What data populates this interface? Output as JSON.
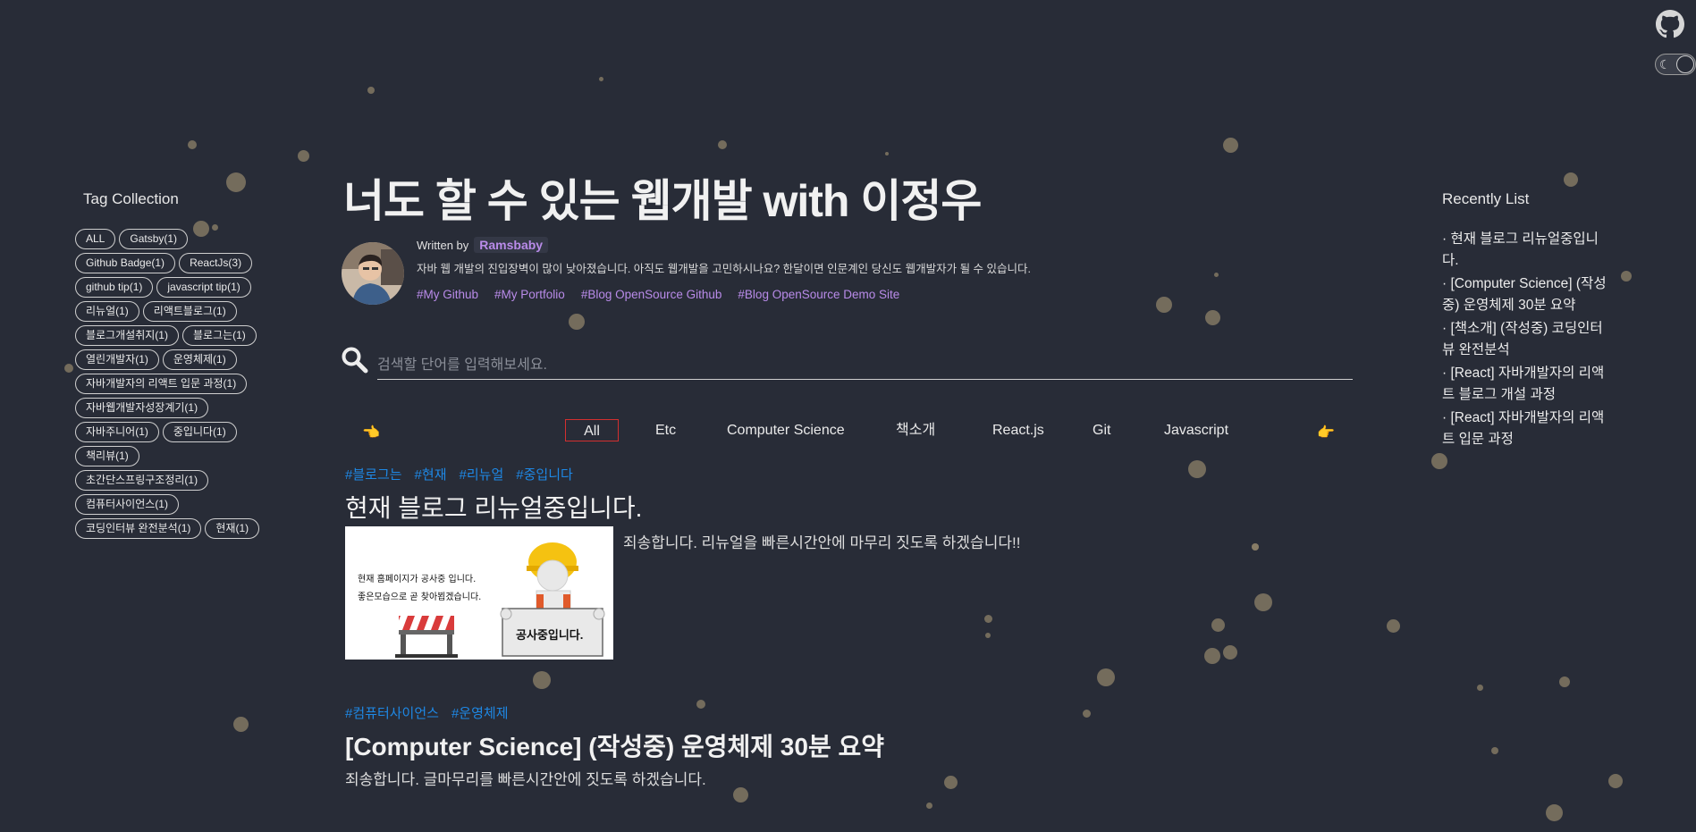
{
  "blog": {
    "title": "너도 할 수 있는 웹개발 with 이정우",
    "written_by": "Written by",
    "author": "Ramsbaby",
    "bio": "자바 웹 개발의 진입장벽이 많이 낮아졌습니다. 아직도 웹개발을 고민하시나요? 한달이면 인문계인 당신도 웹개발자가 될 수 있습니다.",
    "links": [
      "#My Github",
      "#My Portfolio",
      "#Blog OpenSource Github",
      "#Blog OpenSource Demo Site"
    ]
  },
  "search": {
    "placeholder": "검색할 단어를 입력해보세요."
  },
  "tag_collection": {
    "title": "Tag Collection",
    "tags": [
      "ALL",
      "Gatsby(1)",
      "Github Badge(1)",
      "ReactJs(3)",
      "github tip(1)",
      "javascript tip(1)",
      "리뉴얼(1)",
      "리액트블로그(1)",
      "블로그개설취지(1)",
      "블로그는(1)",
      "열린개발자(1)",
      "운영체제(1)",
      "자바개발자의 리액트 입문 과정(1)",
      "자바웹개발자성장계기(1)",
      "자바주니어(1)",
      "중입니다(1)",
      "책리뷰(1)",
      "초간단스프링구조정리(1)",
      "컴퓨터사이언스(1)",
      "코딩인터뷰 완전분석(1)",
      "현재(1)"
    ]
  },
  "categories": {
    "items": [
      "All",
      "Etc",
      "Computer Science",
      "책소개",
      "React.js",
      "Git",
      "Javascript"
    ],
    "active": "All"
  },
  "posts": [
    {
      "tags": [
        "#블로그는",
        "#현재",
        "#리뉴얼",
        "#중입니다"
      ],
      "title": "현재 블로그 리뉴얼중입니다.",
      "excerpt": "죄송합니다. 리뉴얼을 빠른시간안에 마무리 짓도록 하겠습니다!!",
      "thumb_line1": "현재 홈페이지가 공사중 입니다.",
      "thumb_line2": "좋은모습으로 곧 찾아뵙겠습니다.",
      "thumb_sign": "공사중입니다."
    },
    {
      "tags": [
        "#컴퓨터사이언스",
        "#운영체제"
      ],
      "title": "[Computer Science] (작성중) 운영체제 30분 요약",
      "excerpt": "죄송합니다. 글마무리를 빠른시간안에 짓도록 하겠습니다."
    }
  ],
  "recently": {
    "title": "Recently List",
    "items": [
      "· 현재 블로그 리뉴얼중입니다.",
      "· [Computer Science] (작성중) 운영체제 30분 요약",
      "· [책소개] (작성중) 코딩인터뷰 완전분석",
      "· [React] 자바개발자의 리액트 블로그 개설 과정",
      "· [React] 자바개발자의 리액트 입문 과정"
    ]
  },
  "icons": {
    "github": "github-icon",
    "theme_toggle": "dark-mode-toggle",
    "search": "search-icon",
    "hand_left": "pointing-hand-left-icon",
    "hand_right": "pointing-hand-right-icon"
  },
  "colors": {
    "background": "#282c37",
    "link_purple": "#b98be9",
    "tag_blue": "#1e88e5",
    "active_tab_border": "#d32f2f",
    "particle": "#8d816a"
  }
}
